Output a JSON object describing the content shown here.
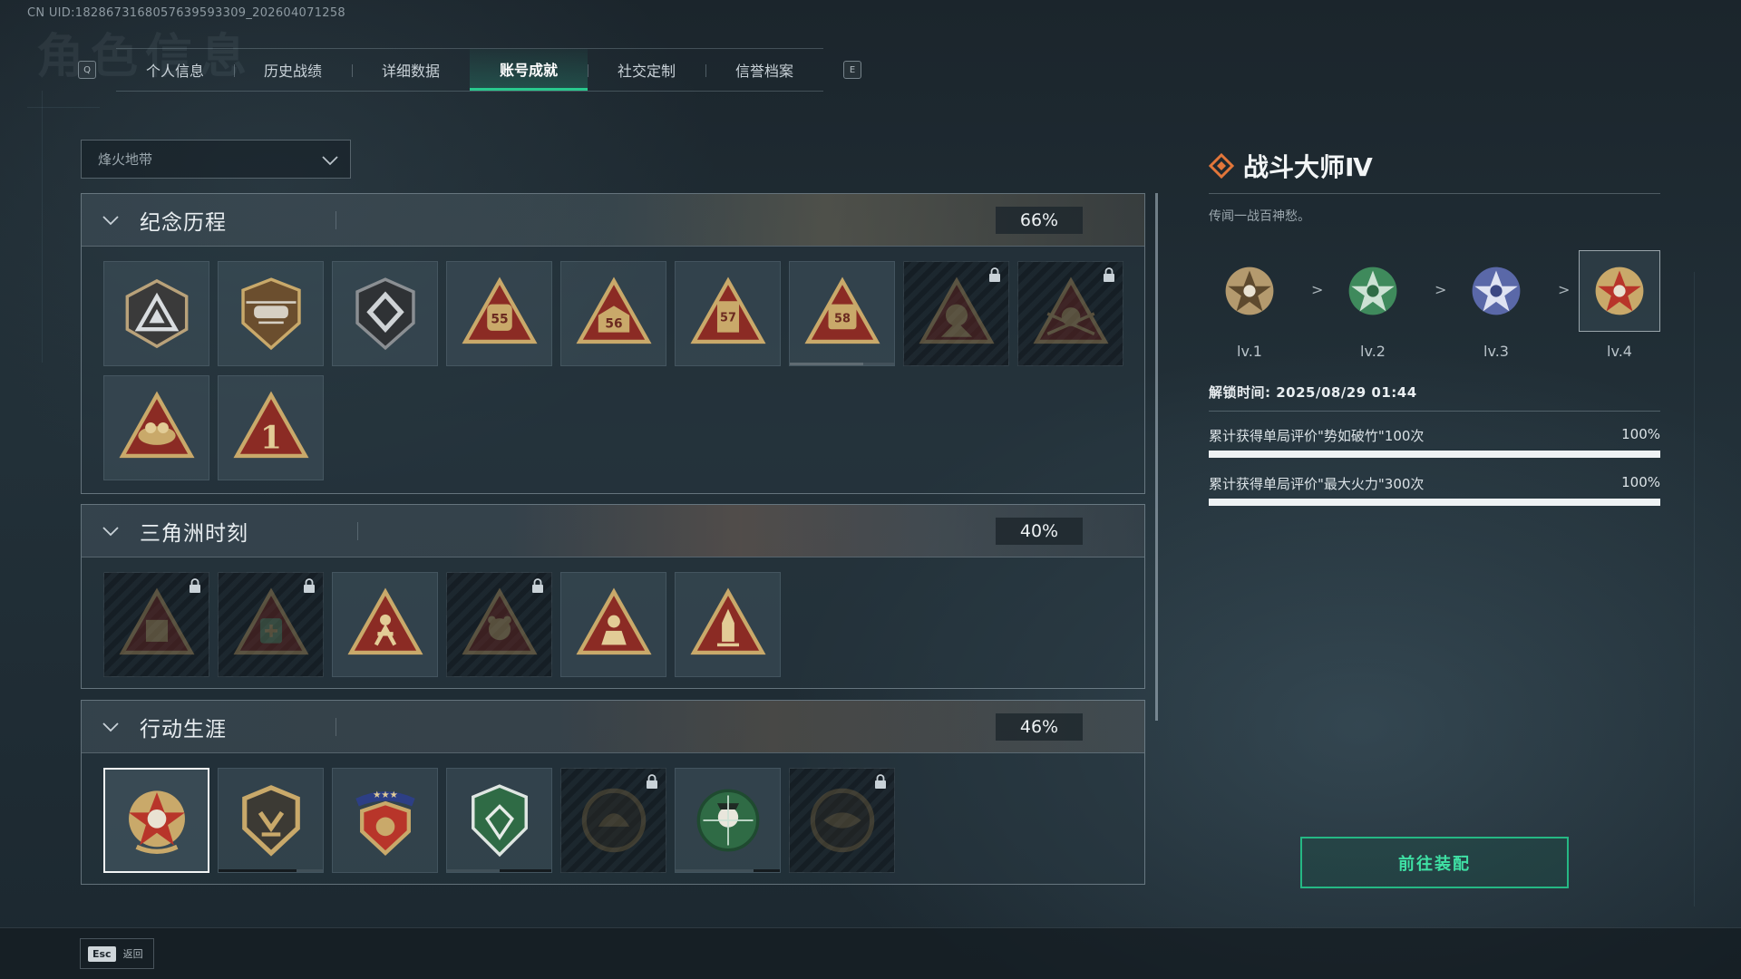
{
  "uid": "CN UID:1828673168057639593309_202604071258",
  "background_title": "角色信息",
  "tabs": {
    "left_key": "Q",
    "right_key": "E",
    "items": [
      "个人信息",
      "历史战绩",
      "详细数据",
      "账号成就",
      "社交定制",
      "信誉档案"
    ],
    "active_index": 3
  },
  "dropdown": {
    "value": "烽火地带"
  },
  "sections": [
    {
      "title": "纪念历程",
      "percent": "66%",
      "badges": [
        {
          "icon": "triangle-a-badge",
          "locked": false
        },
        {
          "icon": "helicopter-badge",
          "locked": false
        },
        {
          "icon": "shield-emblem-badge",
          "locked": false
        },
        {
          "icon": "s55-badge",
          "label": "55",
          "locked": false
        },
        {
          "icon": "s56-badge",
          "label": "56",
          "locked": false
        },
        {
          "icon": "s57-badge",
          "label": "57",
          "locked": false
        },
        {
          "icon": "s58-badge",
          "label": "58",
          "locked": false,
          "progress": 0.7
        },
        {
          "icon": "hooded-figure-badge",
          "locked": true
        },
        {
          "icon": "skull-wings-badge",
          "locked": true
        },
        {
          "icon": "nest-badge",
          "locked": false
        },
        {
          "icon": "number-one-badge",
          "label": "1",
          "locked": false
        }
      ]
    },
    {
      "title": "三角洲时刻",
      "percent": "40%",
      "badges": [
        {
          "icon": "box-badge",
          "locked": true
        },
        {
          "icon": "medkit-badge",
          "locked": true
        },
        {
          "icon": "running-figure-badge",
          "locked": false
        },
        {
          "icon": "bear-badge",
          "locked": true
        },
        {
          "icon": "soldier-badge",
          "locked": false
        },
        {
          "icon": "rocket-badge",
          "locked": false
        }
      ]
    },
    {
      "title": "行动生涯",
      "percent": "46%",
      "badges": [
        {
          "icon": "star-skull-medal",
          "locked": false,
          "selected": true
        },
        {
          "icon": "gold-shield-medal",
          "locked": false,
          "progress": 0.75
        },
        {
          "icon": "winged-star-medal",
          "locked": false
        },
        {
          "icon": "green-shield-medal",
          "locked": false,
          "progress": 0.5
        },
        {
          "icon": "dark-helmet-medal",
          "locked": true
        },
        {
          "icon": "green-skull-medal",
          "locked": false,
          "progress": 0.25
        },
        {
          "icon": "dark-eye-medal",
          "locked": true
        }
      ]
    }
  ],
  "detail": {
    "title": "战斗大师Ⅳ",
    "description": "传闻一战百神愁。",
    "levels": [
      {
        "label": "lv.1",
        "color": "#b49a6e"
      },
      {
        "label": "lv.2",
        "color": "#3f8a5c"
      },
      {
        "label": "lv.3",
        "color": "#5a68a8"
      },
      {
        "label": "lv.4",
        "color": "#c0703a"
      }
    ],
    "level_separator": ">",
    "selected_level_index": 3,
    "unlock_time": "解锁时间: 2025/08/29 01:44",
    "tasks": [
      {
        "text": "累计获得单局评价\"势如破竹\"100次",
        "percent": "100%",
        "progress": 1.0
      },
      {
        "text": "累计获得单局评价\"最大火力\"300次",
        "percent": "100%",
        "progress": 1.0
      }
    ],
    "equip_button": "前往装配"
  },
  "footer": {
    "esc_key": "Esc",
    "esc_label": "返回"
  },
  "colors": {
    "accent_green": "#29c98e",
    "badge_gold": "#c9a96a",
    "badge_red": "#8b2b24",
    "tile_bg": "#3e5260"
  }
}
